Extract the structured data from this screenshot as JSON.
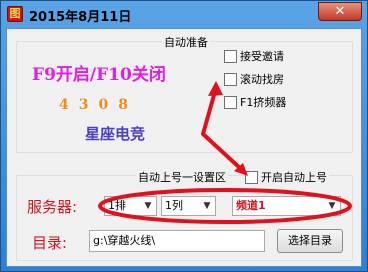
{
  "window": {
    "title": "2015年8月11日",
    "close_glyph": "✕",
    "app_icon_glyph": "图"
  },
  "prep_group": {
    "title": "自动准备",
    "hotkey_text": "F9开启/F10关闭",
    "digits": "4308",
    "brand": "星座电竞",
    "checkboxes": [
      {
        "label": "接受邀请",
        "checked": false
      },
      {
        "label": "滚动找房",
        "checked": false
      },
      {
        "label": "F1挤频器",
        "checked": false
      }
    ]
  },
  "auto_group": {
    "title": "自动上号一设置区",
    "checkbox_label": "开启自动上号",
    "checked": false,
    "server_label": "服务器:",
    "selects": [
      {
        "value": "1排"
      },
      {
        "value": "1列"
      },
      {
        "value": "频道1"
      }
    ],
    "dir_label": "目录:",
    "dir_value": "g:\\穿越火线\\",
    "browse_button": "选择目录"
  },
  "colors": {
    "accent_red": "#e0101c",
    "hotkey_magenta": "#e020e0",
    "digits_orange": "#f08a18",
    "brand_purple": "#4b3fc6"
  }
}
